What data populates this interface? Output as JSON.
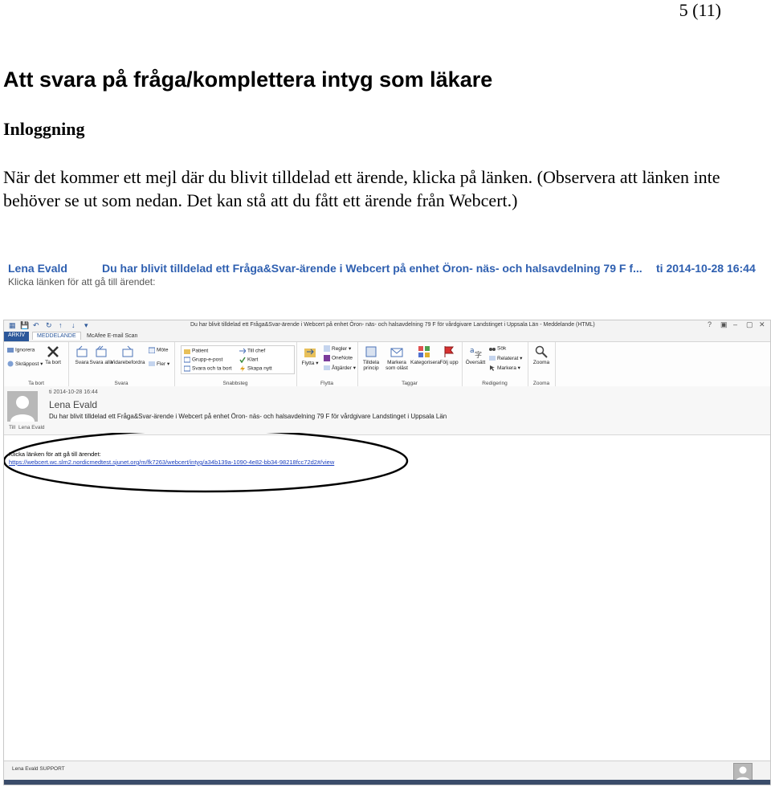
{
  "page": {
    "number": "5 (11)",
    "title": "Att svara på fråga/komplettera intyg som läkare",
    "section_heading": "Inloggning",
    "intro": "När det kommer ett mejl där du blivit tilldelad ett ärende, klicka på länken. (Observera att länken inte behöver se ut som nedan. Det kan stå att du fått ett ärende från Webcert.)"
  },
  "notification": {
    "sender": "Lena Evald",
    "subject": "Du har blivit tilldelad ett Fråga&Svar-ärende i Webcert på enhet Öron- näs- och halsavdelning 79 F f...",
    "time": "ti 2014-10-28 16:44",
    "preview": "Klicka länken för att gå till ärendet:"
  },
  "window": {
    "title": "Du har blivit tilldelad ett Fråga&Svar-ärende i Webcert på enhet Öron- näs- och halsavdelning 79 F för vårdgivare Landstinget i Uppsala Län - Meddelande (HTML)",
    "controls": [
      "?",
      "▣",
      "–",
      "▢",
      "✕"
    ],
    "tabs": {
      "file": "ARKIV",
      "message": "MEDDELANDE",
      "mcafee": "McAfee E-mail Scan"
    },
    "ribbon": {
      "delete_group": {
        "label": "Ta bort",
        "ignore": "Ignorera",
        "junk": "Skräppost",
        "delete": "Ta bort"
      },
      "respond_group": {
        "label": "Svara",
        "reply": "Svara",
        "reply_all": "Svara alla",
        "forward": "Vidarebefordra",
        "meeting": "Möte",
        "more": "Fler"
      },
      "quick_steps": {
        "label": "Snabbsteg",
        "items": [
          "Patient",
          "Grupp-e-post",
          "Svara och ta bort",
          "Till chef",
          "Klart",
          "Skapa nytt"
        ]
      },
      "move_group": {
        "label": "Flytta",
        "move": "Flytta",
        "rules": "Regler",
        "onenote": "OneNote",
        "actions": "Åtgärder"
      },
      "tags_group": {
        "label": "Taggar",
        "assign_policy": "Tilldela princip",
        "mark_unread": "Markera som oläst",
        "categorize": "Kategorisera",
        "follow_up": "Följ upp"
      },
      "editing_group": {
        "label": "Redigering",
        "translate": "Översätt",
        "find": "Sök",
        "related": "Relaterat",
        "select": "Markera"
      },
      "zoom_group": {
        "label": "Zooma",
        "zoom": "Zooma"
      }
    }
  },
  "message": {
    "datetime": "ti 2014-10-28 16:44",
    "sender": "Lena Evald",
    "subject": "Du har blivit tilldelad ett Fråga&Svar-ärende i Webcert på enhet Öron- näs- och halsavdelning 79 F för vårdgivare Landstinget i Uppsala Län",
    "to_label": "Till",
    "to_name": "Lena Evald",
    "body_text": "Klicka länken för att gå till ärendet:",
    "link": "https://webcert.wc.slm2.nordicmedtest.sjunet.org/m/fk7263/webcert/intyg/a34b139a-1090-4e82-bb34-98218fcc72d2#/view"
  },
  "status": {
    "name": "Lena Evald SUPPORT"
  },
  "colors": {
    "accent": "#2b579a",
    "banner_text": "#2e5fb0",
    "link": "#1b3fbf",
    "highlight": "#000000"
  }
}
